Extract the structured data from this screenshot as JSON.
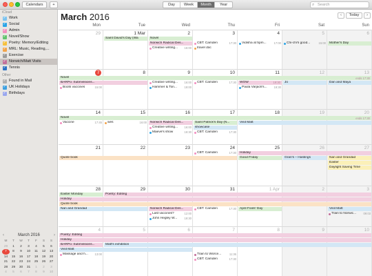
{
  "toolbar": {
    "calendars_label": "Calendars",
    "add_label": "+",
    "views": [
      "Day",
      "Week",
      "Month",
      "Year"
    ],
    "active_view": "Month",
    "search_placeholder": "Search"
  },
  "sidebar": {
    "icloud_heading": "iCloud",
    "calendars": [
      {
        "label": "Work",
        "color": "#7cc3ef"
      },
      {
        "label": "Social",
        "color": "#2aa4e6"
      },
      {
        "label": "Admin",
        "color": "#f38fc0"
      },
      {
        "label": "Novel/Show",
        "color": "#63c36f"
      },
      {
        "label": "Poetry: Memory/Editing",
        "color": "#f6c03d"
      },
      {
        "label": "MRL: Music, Reading,...",
        "color": "#f3a44a"
      },
      {
        "label": "Exercise",
        "color": "#9a9a9a"
      },
      {
        "label": "Norwich/Matt Visits",
        "color": "#c36f9a"
      },
      {
        "label": "Tennis",
        "color": "#2d72c3"
      }
    ],
    "other_heading": "Other",
    "other": [
      {
        "label": "Found in Mail",
        "color": "#b0b0b0"
      },
      {
        "label": "UK Holidays",
        "color": "#3da0e0"
      },
      {
        "label": "Birthdays",
        "color": "#9aa7ef"
      }
    ]
  },
  "mini_calendar": {
    "title": "March 2016",
    "prev": "‹",
    "next": "›",
    "dow": [
      "M",
      "T",
      "W",
      "T",
      "F",
      "S",
      "S"
    ],
    "days": [
      "29",
      "1",
      "2",
      "3",
      "4",
      "5",
      "6",
      "7",
      "8",
      "9",
      "10",
      "11",
      "12",
      "13",
      "14",
      "15",
      "16",
      "17",
      "18",
      "19",
      "20",
      "21",
      "22",
      "23",
      "24",
      "25",
      "26",
      "27",
      "28",
      "29",
      "30",
      "31",
      "1",
      "2",
      "3",
      "4",
      "5",
      "6",
      "7",
      "8",
      "9",
      "10"
    ],
    "today": "7"
  },
  "header": {
    "month": "March",
    "year": "2016",
    "prev": "‹",
    "today_label": "Today",
    "next": "›"
  },
  "dow": [
    "Mon",
    "Tue",
    "Wed",
    "Thu",
    "Fri",
    "Sat",
    "Sun"
  ],
  "weeks": [
    {
      "days": [
        {
          "n": "29",
          "dim": true
        },
        {
          "n": "1 Mar"
        },
        {
          "n": "2"
        },
        {
          "n": "3"
        },
        {
          "n": "4"
        },
        {
          "n": "5",
          "dim": true
        },
        {
          "n": "6",
          "dim": true
        }
      ]
    },
    {
      "days": [
        {
          "n": "7",
          "today": true
        },
        {
          "n": "8"
        },
        {
          "n": "9"
        },
        {
          "n": "10"
        },
        {
          "n": "11"
        },
        {
          "n": "12",
          "dim": true
        },
        {
          "n": "13",
          "dim": true
        }
      ]
    },
    {
      "days": [
        {
          "n": "14"
        },
        {
          "n": "15"
        },
        {
          "n": "16"
        },
        {
          "n": "17"
        },
        {
          "n": "18"
        },
        {
          "n": "19",
          "dim": true
        },
        {
          "n": "20",
          "dim": true
        }
      ]
    },
    {
      "days": [
        {
          "n": "21"
        },
        {
          "n": "22"
        },
        {
          "n": "23"
        },
        {
          "n": "24"
        },
        {
          "n": "25"
        },
        {
          "n": "26",
          "dim": true
        },
        {
          "n": "27",
          "dim": true
        }
      ]
    },
    {
      "days": [
        {
          "n": "28"
        },
        {
          "n": "29"
        },
        {
          "n": "30"
        },
        {
          "n": "31"
        },
        {
          "n": "1 Apr",
          "dim": true
        },
        {
          "n": "2",
          "dim": true
        },
        {
          "n": "3",
          "dim": true
        }
      ]
    },
    {
      "days": [
        {
          "n": "4",
          "dim": true
        },
        {
          "n": "5",
          "dim": true
        },
        {
          "n": "6",
          "dim": true
        },
        {
          "n": "7",
          "dim": true
        },
        {
          "n": "8",
          "dim": true
        },
        {
          "n": "9",
          "dim": true
        },
        {
          "n": "10",
          "dim": true
        }
      ]
    }
  ],
  "bars": [
    {
      "w": 0,
      "start": 1,
      "span": 1,
      "row": 0,
      "label": "Saint David's Day (Wa",
      "color": "#d8eed2"
    },
    {
      "w": 0,
      "start": 2,
      "span": 1,
      "row": 0,
      "label": "Novel",
      "color": "#d8eed2"
    },
    {
      "w": 0,
      "start": 2,
      "span": 1,
      "row": 1,
      "label": "Norwich Radical Des...",
      "color": "#f2cfe0"
    },
    {
      "w": 0,
      "start": 6,
      "span": 1,
      "row": 1,
      "label": "Mother's Day",
      "color": "#d8eed2"
    },
    {
      "w": 1,
      "start": 0,
      "span": 7,
      "row": 0,
      "label": "Novel",
      "color": "#d8eed2"
    },
    {
      "w": 1,
      "start": 0,
      "span": 2,
      "row": 1,
      "label": "BARPo: Submissions...",
      "color": "#f2cfe0"
    },
    {
      "w": 1,
      "start": 4,
      "span": 1,
      "row": 1,
      "label": "WOW",
      "color": "#f2cfe0",
      "time": "19:30"
    },
    {
      "w": 1,
      "start": 5,
      "span": 1,
      "row": 1,
      "label": "Jo",
      "color": "#d3e7f5"
    },
    {
      "w": 1,
      "start": 6,
      "span": 1,
      "row": 1,
      "label": "Dan and Maya",
      "color": "#d3e7f5"
    },
    {
      "w": 2,
      "start": 0,
      "span": 7,
      "row": 0,
      "label": "Novel",
      "color": "#d8eed2"
    },
    {
      "w": 2,
      "start": 2,
      "span": 1,
      "row": 1,
      "label": "Norwich Radical Des...",
      "color": "#f2cfe0"
    },
    {
      "w": 2,
      "start": 3,
      "span": 1,
      "row": 1,
      "label": "Saint Patrick's Day (N...",
      "color": "#d8eed2"
    },
    {
      "w": 2,
      "start": 3,
      "span": 1,
      "row": 2,
      "label": "showcase",
      "color": "#d3e7f5"
    },
    {
      "w": 2,
      "start": 4,
      "span": 3,
      "row": 1,
      "label": "Visit Matt",
      "color": "#d3e7f5"
    },
    {
      "w": 3,
      "start": 0,
      "span": 4,
      "row": 1,
      "label": "Quote book",
      "color": "#fbe2c5"
    },
    {
      "w": 3,
      "start": 4,
      "span": 3,
      "row": 0,
      "label": "Holiday",
      "color": "#f2cfe0"
    },
    {
      "w": 3,
      "start": 4,
      "span": 1,
      "row": 1,
      "label": "Good Friday",
      "color": "#d8eed2"
    },
    {
      "w": 3,
      "start": 5,
      "span": 1,
      "row": 1,
      "label": "Gran's – Hastings",
      "color": "#d3e7f5"
    },
    {
      "w": 3,
      "start": 6,
      "span": 1,
      "row": 1,
      "label": "Nan and Grandad",
      "color": "#fbf0b8"
    },
    {
      "w": 3,
      "start": 6,
      "span": 1,
      "row": 2,
      "label": "Easter",
      "color": "#fbf0b8"
    },
    {
      "w": 3,
      "start": 6,
      "span": 1,
      "row": 3,
      "label": "Daylight Saving Time",
      "color": "#fbf0b8"
    },
    {
      "w": 4,
      "start": 0,
      "span": 1,
      "row": 0,
      "label": "Easter Monday",
      "color": "#d8eed2"
    },
    {
      "w": 4,
      "start": 1,
      "span": 6,
      "row": 0,
      "label": "Poetry: Editing",
      "color": "#f2cfe0"
    },
    {
      "w": 4,
      "start": 0,
      "span": 7,
      "row": 1,
      "label": "Holiday",
      "color": "#f2cfe0"
    },
    {
      "w": 4,
      "start": 0,
      "span": 7,
      "row": 2,
      "label": "Quote book",
      "color": "#fbe2c5"
    },
    {
      "w": 4,
      "start": 0,
      "span": 2,
      "row": 3,
      "label": "Nan and Grandad",
      "color": "#d3e7f5"
    },
    {
      "w": 4,
      "start": 2,
      "span": 1,
      "row": 3,
      "label": "Norwich Radical Des...",
      "color": "#f2cfe0"
    },
    {
      "w": 4,
      "start": 4,
      "span": 1,
      "row": 3,
      "label": "April Fools' Day",
      "color": "#d8eed2"
    },
    {
      "w": 4,
      "start": 6,
      "span": 1,
      "row": 3,
      "label": "Visit Matt",
      "color": "#d3e7f5"
    },
    {
      "w": 5,
      "start": 0,
      "span": 7,
      "row": 0,
      "label": "Poetry: Editing",
      "color": "#f2cfe0"
    },
    {
      "w": 5,
      "start": 0,
      "span": 7,
      "row": 1,
      "label": "Holiday",
      "color": "#f2cfe0"
    },
    {
      "w": 5,
      "start": 0,
      "span": 1,
      "row": 2,
      "label": "BARPo: Submissions...",
      "color": "#f2cfe0"
    },
    {
      "w": 5,
      "start": 1,
      "span": 6,
      "row": 2,
      "label": "Matt's exhibition",
      "color": "#d3e7f5"
    },
    {
      "w": 5,
      "start": 0,
      "span": 3,
      "row": 3,
      "label": "Visit Matt",
      "color": "#d3e7f5"
    }
  ],
  "events": [
    {
      "w": 0,
      "day": 2,
      "row": 2,
      "label": "Creative writing...",
      "time": "16:00",
      "color": "#f38fc0"
    },
    {
      "w": 0,
      "day": 3,
      "row": 1,
      "label": "CBT: Camden",
      "time": "17:30",
      "color": "#f38fc0"
    },
    {
      "w": 0,
      "day": 3,
      "row": 2,
      "label": "travel doc",
      "color": "#f3a44a"
    },
    {
      "w": 0,
      "day": 4,
      "row": 1,
      "label": "Vidisha at 5pm...",
      "time": "17:00",
      "color": "#2aa4e6"
    },
    {
      "w": 0,
      "day": 5,
      "row": 1,
      "label": "Chi-chi's good...",
      "time": "15:00",
      "color": "#2aa4e6"
    },
    {
      "w": 1,
      "day": 0,
      "row": 2,
      "label": "Boots vaccines",
      "time": "15:00",
      "color": "#f38fc0"
    },
    {
      "w": 1,
      "day": 2,
      "row": 1,
      "label": "Creative writing...",
      "time": "16:00",
      "color": "#f38fc0"
    },
    {
      "w": 1,
      "day": 2,
      "row": 2,
      "label": "Hammer & Ton...",
      "time": "19:00",
      "color": "#2aa4e6"
    },
    {
      "w": 1,
      "day": 3,
      "row": 1,
      "label": "CBT: Camden",
      "time": "17:30",
      "color": "#f38fc0"
    },
    {
      "w": 1,
      "day": 4,
      "row": 2,
      "label": "Paula Varjack's...",
      "time": "19:30",
      "color": "#2aa4e6"
    },
    {
      "w": 2,
      "day": 0,
      "row": 1,
      "label": "Vaccine",
      "time": "17:45",
      "color": "#f38fc0"
    },
    {
      "w": 2,
      "day": 1,
      "row": 1,
      "label": "wes",
      "time": "16:00",
      "color": "#f3a44a"
    },
    {
      "w": 2,
      "day": 2,
      "row": 2,
      "label": "Creative writing...",
      "time": "16:00",
      "color": "#f38fc0"
    },
    {
      "w": 2,
      "day": 2,
      "row": 3,
      "label": "Maeve's show",
      "time": "19:30",
      "color": "#2aa4e6"
    },
    {
      "w": 2,
      "day": 3,
      "row": 3,
      "label": "CBT: Camden",
      "time": "17:30",
      "color": "#f38fc0"
    },
    {
      "w": 3,
      "day": 3,
      "row": 0,
      "label": "CBT: Camden",
      "time": "17:30",
      "color": "#f38fc0"
    },
    {
      "w": 4,
      "day": 2,
      "row": 4,
      "label": "Last vaccines?",
      "time": "12:00",
      "color": "#f38fc0"
    },
    {
      "w": 4,
      "day": 2,
      "row": 5,
      "label": "John Hegley W...",
      "time": "19:30",
      "color": "#2aa4e6"
    },
    {
      "w": 4,
      "day": 3,
      "row": 3,
      "label": "CBT: Camden",
      "time": "17:30",
      "color": "#f38fc0"
    },
    {
      "w": 4,
      "day": 6,
      "row": 4,
      "label": "Train to Norwic...",
      "time": "09:03",
      "color": "#c36f9a"
    },
    {
      "w": 5,
      "day": 0,
      "row": 4,
      "label": "Massage and h...",
      "time": "13:00",
      "color": "#f38fc0"
    },
    {
      "w": 5,
      "day": 3,
      "row": 4,
      "label": "Train to Worce...",
      "time": "11:36",
      "color": "#c36f9a"
    },
    {
      "w": 5,
      "day": 3,
      "row": 5,
      "label": "CBT: Camden",
      "time": "17:30",
      "color": "#f38fc0"
    }
  ],
  "week_notes": [
    {
      "w": 1,
      "label": "ends 17:30"
    },
    {
      "w": 2,
      "label": "ends 17:30"
    }
  ]
}
